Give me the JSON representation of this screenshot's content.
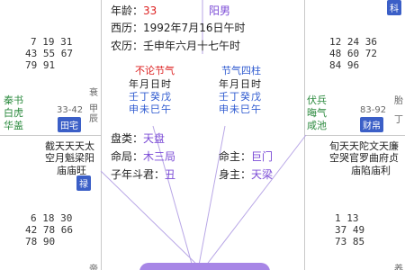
{
  "center": {
    "age_label": "年龄：",
    "age_value": "33",
    "gender": "阳男",
    "solar_label": "西历：",
    "solar_value": "1992年7月16日午时",
    "lunar_label": "农历：",
    "lunar_value": "壬申年六月十七午时",
    "pillars_left_title": "不论节气",
    "pillars_right_title": "节气四柱",
    "pillar_header": "年月日时",
    "pillar_stems": "壬丁癸戊",
    "pillar_branches": "申未巳午",
    "plate_label": "盘类：",
    "plate_value": "天盘",
    "bureau_label": "命局：",
    "bureau_value": "木三局",
    "ming_zhu_label": "命主：",
    "ming_zhu_value": "巨门",
    "zi_dou_label": "子年斗君：",
    "zi_dou_value": "丑",
    "shen_zhu_label": "身主：",
    "shen_zhu_value": "天梁"
  },
  "palaces": {
    "top_left": {
      "nums_row1": "7  19  31",
      "nums_row2": "43  55  67",
      "nums_row3": "79  91",
      "stars": [
        "秦书",
        "白虎",
        "华盖"
      ],
      "age_range": "33-42",
      "label": "田宅",
      "branch_side": "衰",
      "side_text": "甲辰"
    },
    "top_right": {
      "nums_row1": "12  24  36",
      "nums_row2": "48  60  72",
      "nums_row3": "84  96",
      "stars": [
        "伏兵",
        "晦气",
        "咸池"
      ],
      "age_range": "83-92",
      "label": "财帛",
      "branch_side": "胎",
      "side_text": "丁"
    },
    "bottom_left": {
      "star_cols": "截天天天太",
      "star_cols2": "空月魁梁阳",
      "brightness": "庙庙旺",
      "hua": "禄",
      "nums_row1": "6  18  30",
      "nums_row2": "42  78  66",
      "nums_row3": "78  90",
      "branch_side": "帝"
    },
    "bottom_right": {
      "star_cols": "旬天天陀文天廉",
      "star_cols2": "空哭官罗曲府贞",
      "brightness": "庙陷庙利",
      "nums_row1": "1  13",
      "nums_row2": "37  49",
      "nums_row3": "73  85",
      "branch_side": "养"
    },
    "top_right_badge": "科"
  },
  "colors": {
    "accent": "#3b5fc7",
    "pill": "#a786e6",
    "red": "#dd2222",
    "green": "#2b8a3e"
  }
}
